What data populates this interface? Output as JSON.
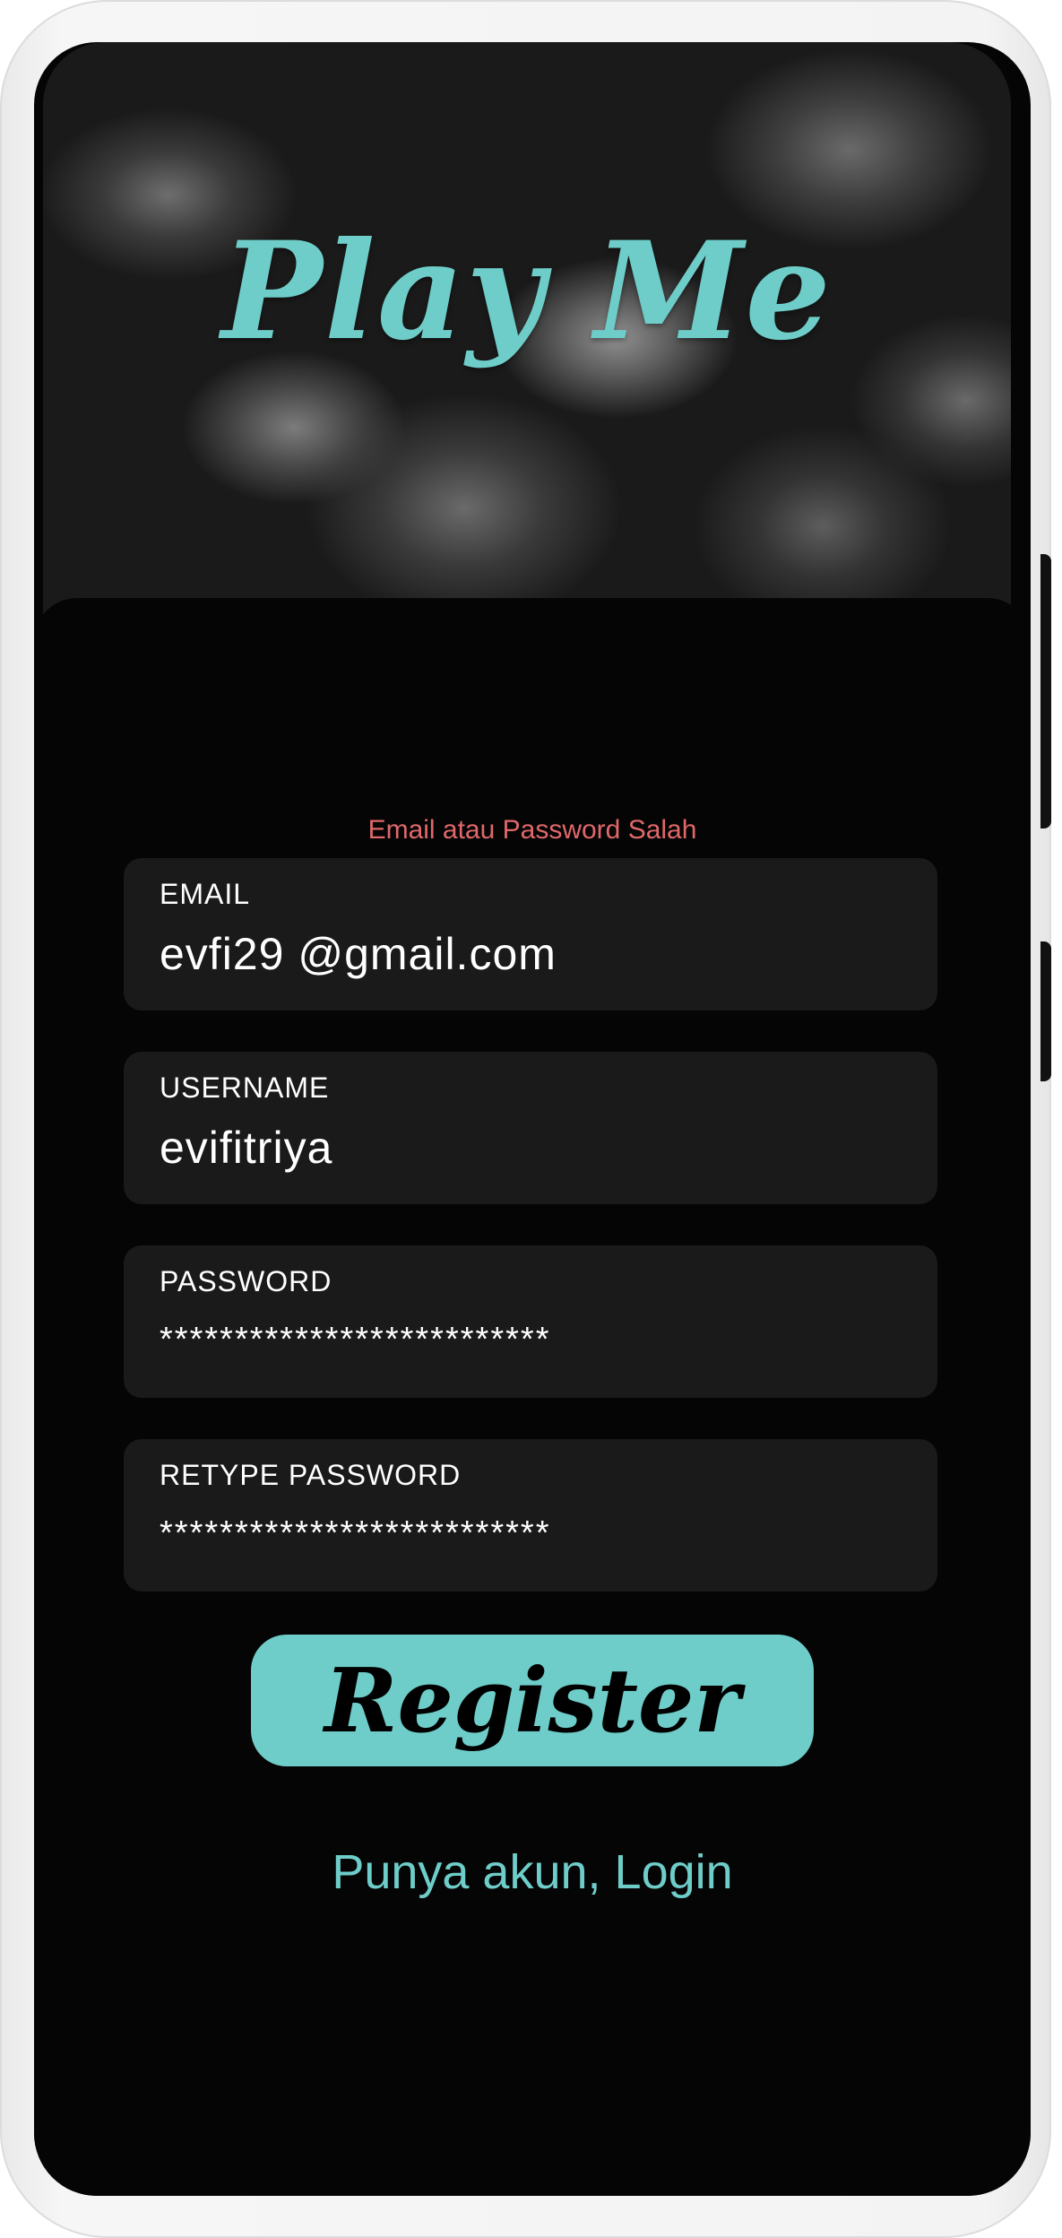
{
  "app": {
    "title": "Play Me"
  },
  "form": {
    "error_message": "Email atau Password Salah",
    "fields": [
      {
        "label": "EMAIL",
        "value": "evfi29 @gmail.com"
      },
      {
        "label": "USERNAME",
        "value": "evifitriya"
      },
      {
        "label": "PASSWORD",
        "value": "**************************"
      },
      {
        "label": "RETYPE PASSWORD",
        "value": "**************************"
      }
    ],
    "register_label": "Register",
    "login_link": "Punya akun, Login"
  },
  "colors": {
    "accent": "#6ecdc9",
    "error": "#e0686a",
    "background": "#050505",
    "field_background": "#1a1a1a"
  }
}
